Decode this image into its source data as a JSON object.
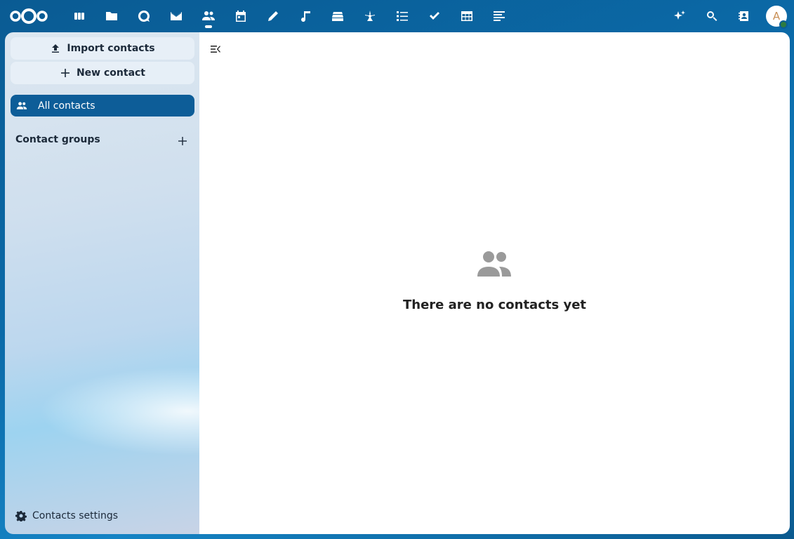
{
  "header": {
    "app_icons": [
      "dashboard-icon",
      "files-icon",
      "talk-icon",
      "mail-icon",
      "contacts-icon",
      "calendar-icon",
      "notes-icon",
      "music-icon",
      "deck-icon",
      "activity-icon",
      "tasks-icon",
      "checklist-icon",
      "tables-icon",
      "collectives-icon"
    ],
    "active_app": "contacts-icon",
    "avatar_initial": "A"
  },
  "sidebar": {
    "import_label": "Import contacts",
    "new_label": "New contact",
    "all_contacts_label": "All contacts",
    "groups_heading": "Contact groups",
    "settings_label": "Contacts settings"
  },
  "main": {
    "empty_text": "There are no contacts yet"
  }
}
